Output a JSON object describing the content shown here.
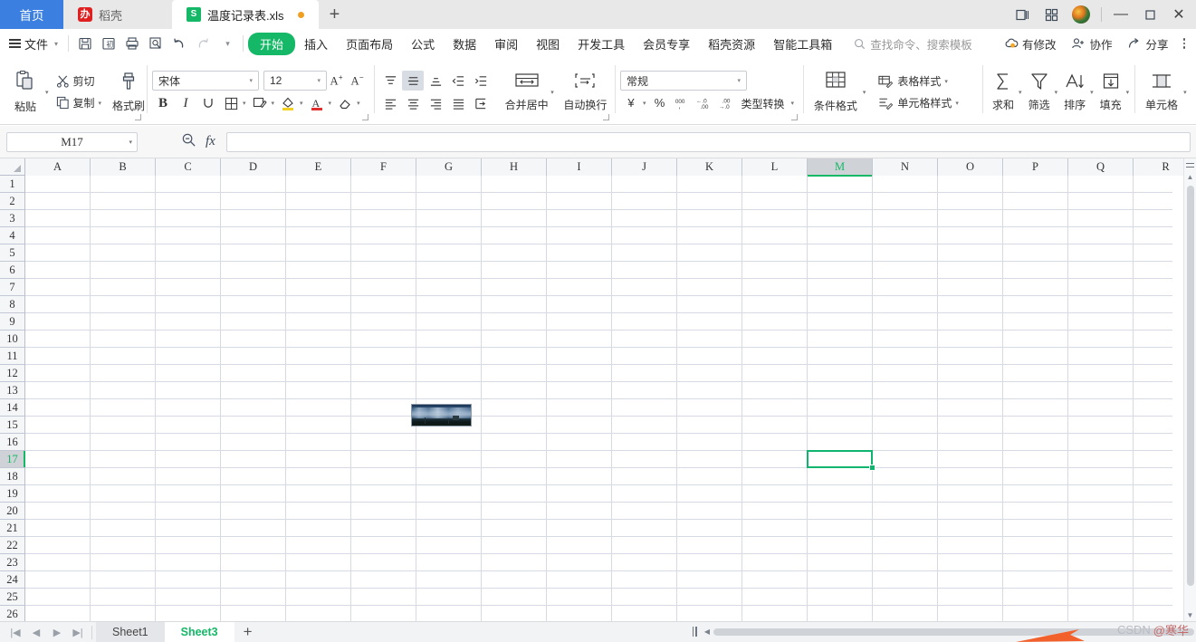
{
  "window": {
    "tabs": [
      {
        "label": "首页",
        "icon": "home-tab",
        "kind": "home"
      },
      {
        "label": "稻壳",
        "icon": "docer-icon",
        "kind": "docer"
      },
      {
        "label": "温度记录表.xls",
        "icon": "spreadsheet-icon",
        "kind": "file"
      }
    ],
    "new_tab_label": "+",
    "controls": {
      "sidebar_label": "▯",
      "grid_label": "▦",
      "minimize": "—",
      "maximize": "▫",
      "close": "✕"
    }
  },
  "menubar": {
    "file_label": "文件",
    "quick_access": [
      {
        "name": "save-icon",
        "glyph": "save"
      },
      {
        "name": "save-as-icon",
        "glyph": "saveas"
      },
      {
        "name": "print-icon",
        "glyph": "print"
      },
      {
        "name": "print-preview-icon",
        "glyph": "preview"
      },
      {
        "name": "undo-icon",
        "glyph": "↺"
      },
      {
        "name": "redo-icon",
        "glyph": "↻"
      },
      {
        "name": "customize-icon",
        "glyph": "▾"
      }
    ],
    "items": [
      "开始",
      "插入",
      "页面布局",
      "公式",
      "数据",
      "审阅",
      "视图",
      "开发工具",
      "会员专享",
      "稻壳资源",
      "智能工具箱"
    ],
    "active_item": "开始",
    "search_placeholder": "查找命令、搜索模板",
    "right_actions": [
      {
        "label": "有修改",
        "icon": "cloud-modified-icon"
      },
      {
        "label": "协作",
        "icon": "collaborate-icon"
      },
      {
        "label": "分享",
        "icon": "share-icon"
      }
    ]
  },
  "ribbon": {
    "clipboard": {
      "paste_label": "粘贴",
      "cut_label": "剪切",
      "copy_label": "复制",
      "format_painter_label": "格式刷"
    },
    "font": {
      "font_name": "宋体",
      "font_size": "12",
      "grow_label": "A⁺",
      "shrink_label": "A⁻",
      "bold_label": "B",
      "italic_label": "I",
      "underline_label": "U",
      "border_label": "田",
      "effects_label": "效果",
      "highlight_label": "突出显示",
      "font_color_label": "A",
      "clear_label": "清除格式"
    },
    "alignment": {
      "align_top": "顶端对齐",
      "align_middle": "垂直居中",
      "align_bottom": "底端对齐",
      "decrease_indent": "减少缩进",
      "increase_indent": "增加缩进",
      "align_left": "左对齐",
      "align_center": "居中",
      "align_right": "右对齐",
      "justify": "两端对齐",
      "orientation": "文字方向",
      "merge_label": "合并居中",
      "wrap_label": "自动换行"
    },
    "number": {
      "format_value": "常规",
      "currency_label": "¥",
      "percent_label": "%",
      "comma_label": "000,",
      "decrease_decimal_label": "←.0",
      "increase_decimal_label": ".00",
      "convert_label": "类型转换"
    },
    "styles": {
      "conditional_label": "条件格式",
      "table_style_label": "表格样式",
      "cell_style_label": "单元格样式"
    },
    "editing": {
      "sum_label": "求和",
      "filter_label": "筛选",
      "sort_label": "排序",
      "fill_label": "填充",
      "cells_label": "单元格"
    }
  },
  "formula_bar": {
    "name_box_value": "M17",
    "zoom_icon": "zoom-out-icon",
    "fx_label": "fx",
    "formula_value": ""
  },
  "grid": {
    "columns": [
      "A",
      "B",
      "C",
      "D",
      "E",
      "F",
      "G",
      "H",
      "I",
      "J",
      "K",
      "L",
      "M",
      "N",
      "O",
      "P",
      "Q",
      "R"
    ],
    "active_column": "M",
    "rows": [
      1,
      2,
      3,
      4,
      5,
      6,
      7,
      8,
      9,
      10,
      11,
      12,
      13,
      14,
      15,
      16,
      17,
      18,
      19,
      20,
      21,
      22,
      23,
      24,
      25,
      26
    ],
    "active_row": 17,
    "selected_cell": "M17",
    "embedded_image": {
      "name": "landscape-photo",
      "anchor_cell": "G14",
      "description": "小幅风景照片"
    }
  },
  "sheet_tabs": {
    "nav": [
      "|◀",
      "◀",
      "▶",
      "▶|"
    ],
    "sheets": [
      {
        "label": "Sheet1",
        "active": false
      },
      {
        "label": "Sheet3",
        "active": true
      }
    ],
    "add_label": "+"
  },
  "watermark": {
    "prefix": "CSDN",
    "handle": "@寒华"
  },
  "colors": {
    "accent_green": "#14b866",
    "home_blue": "#3b7fe0",
    "docer_red": "#e02020",
    "grid_line": "#d6dae2",
    "header_bg": "#f5f6f8"
  }
}
